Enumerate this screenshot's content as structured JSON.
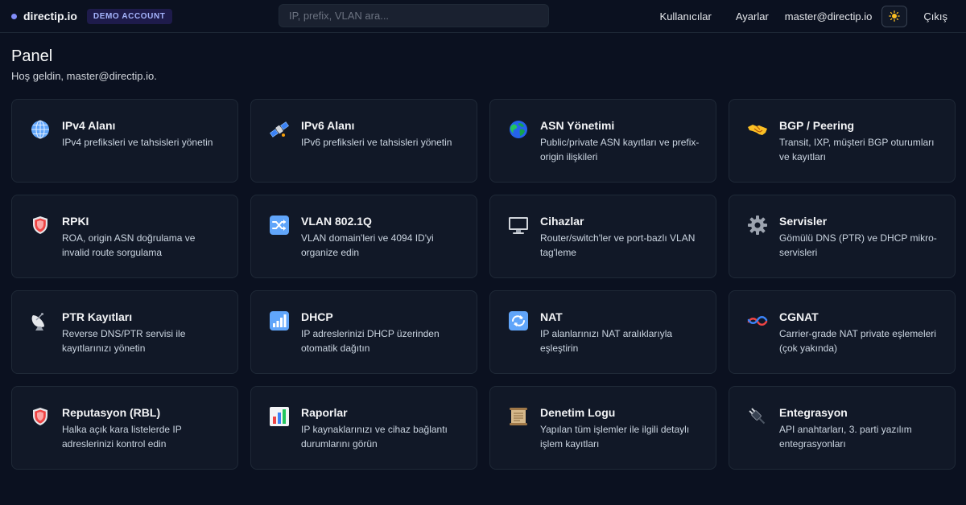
{
  "header": {
    "brand": "directip.io",
    "badge": "DEMO ACCOUNT",
    "search_placeholder": "IP, prefix, VLAN ara...",
    "nav": {
      "users": "Kullanıcılar",
      "settings": "Ayarlar",
      "email": "master@directip.io",
      "theme_icon": "sun-icon",
      "logout": "Çıkış"
    }
  },
  "page": {
    "title": "Panel",
    "subtitle": "Hoş geldin, master@directip.io."
  },
  "cards": [
    {
      "title": "IPv4 Alanı",
      "desc": "IPv4 prefiksleri ve tahsisleri yönetin",
      "icon": "globe-icon"
    },
    {
      "title": "IPv6 Alanı",
      "desc": "IPv6 prefiksleri ve tahsisleri yönetin",
      "icon": "satellite-icon"
    },
    {
      "title": "ASN Yönetimi",
      "desc": "Public/private ASN kayıtları ve prefix-origin ilişkileri",
      "icon": "earth-icon"
    },
    {
      "title": "BGP / Peering",
      "desc": "Transit, IXP, müşteri BGP oturumları ve kayıtları",
      "icon": "handshake-icon"
    },
    {
      "title": "RPKI",
      "desc": "ROA, origin ASN doğrulama ve invalid route sorgulama",
      "icon": "shield-icon"
    },
    {
      "title": "VLAN 802.1Q",
      "desc": "VLAN domain'leri ve 4094 ID'yi organize edin",
      "icon": "shuffle-icon"
    },
    {
      "title": "Cihazlar",
      "desc": "Router/switch'ler ve port-bazlı VLAN tag'leme",
      "icon": "monitor-icon"
    },
    {
      "title": "Servisler",
      "desc": "Gömülü DNS (PTR) ve DHCP mikro-servisleri",
      "icon": "gear-icon"
    },
    {
      "title": "PTR Kayıtları",
      "desc": "Reverse DNS/PTR servisi ile kayıtlarınızı yönetin",
      "icon": "satellite-dish-icon"
    },
    {
      "title": "DHCP",
      "desc": "IP adreslerinizi DHCP üzerinden otomatik dağıtın",
      "icon": "signal-bars-icon"
    },
    {
      "title": "NAT",
      "desc": "IP alanlarınızı NAT aralıklarıyla eşleştirin",
      "icon": "repeat-icon"
    },
    {
      "title": "CGNAT",
      "desc": "Carrier-grade NAT private eşlemeleri (çok yakında)",
      "icon": "knot-icon"
    },
    {
      "title": "Reputasyon (RBL)",
      "desc": "Halka açık kara listelerde IP adreslerinizi kontrol edin",
      "icon": "shield-icon"
    },
    {
      "title": "Raporlar",
      "desc": "IP kaynaklarınızı ve cihaz bağlantı durumlarını görün",
      "icon": "bar-chart-icon"
    },
    {
      "title": "Denetim Logu",
      "desc": "Yapılan tüm işlemler ile ilgili detaylı işlem kayıtları",
      "icon": "scroll-icon"
    },
    {
      "title": "Entegrasyon",
      "desc": "API anahtarları, 3. parti yazılım entegrasyonları",
      "icon": "plug-icon"
    }
  ]
}
